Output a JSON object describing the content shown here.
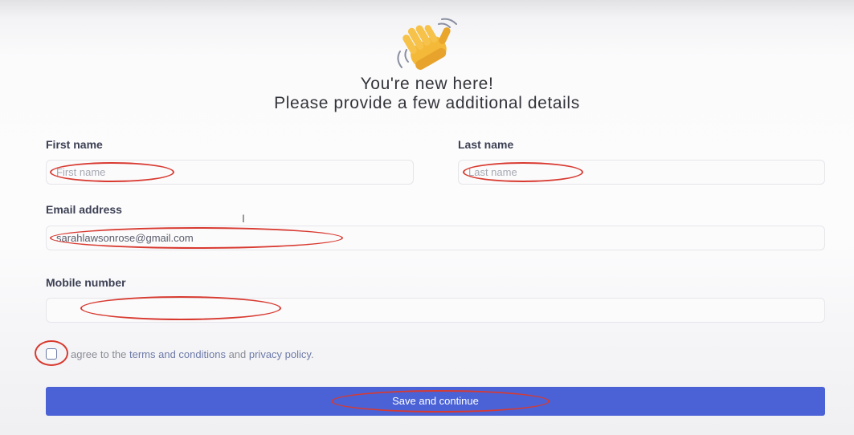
{
  "header": {
    "line1": "You're new here!",
    "line2": "Please provide a few additional details"
  },
  "form": {
    "first_name": {
      "label": "First name",
      "placeholder": "First name",
      "value": ""
    },
    "last_name": {
      "label": "Last name",
      "placeholder": "Last name",
      "value": ""
    },
    "email": {
      "label": "Email address",
      "value": "sarahlawsonrose@gmail.com"
    },
    "mobile": {
      "label": "Mobile number",
      "value": ""
    },
    "agree": {
      "prefix": "agree to the ",
      "terms_link": "terms and conditions",
      "middle": " and ",
      "privacy_link": "privacy policy",
      "suffix": "."
    },
    "submit_label": "Save and continue"
  },
  "icons": {
    "wave": "waving-hand-icon"
  },
  "colors": {
    "accent": "#4a62d6",
    "annotation": "#d83a30"
  }
}
